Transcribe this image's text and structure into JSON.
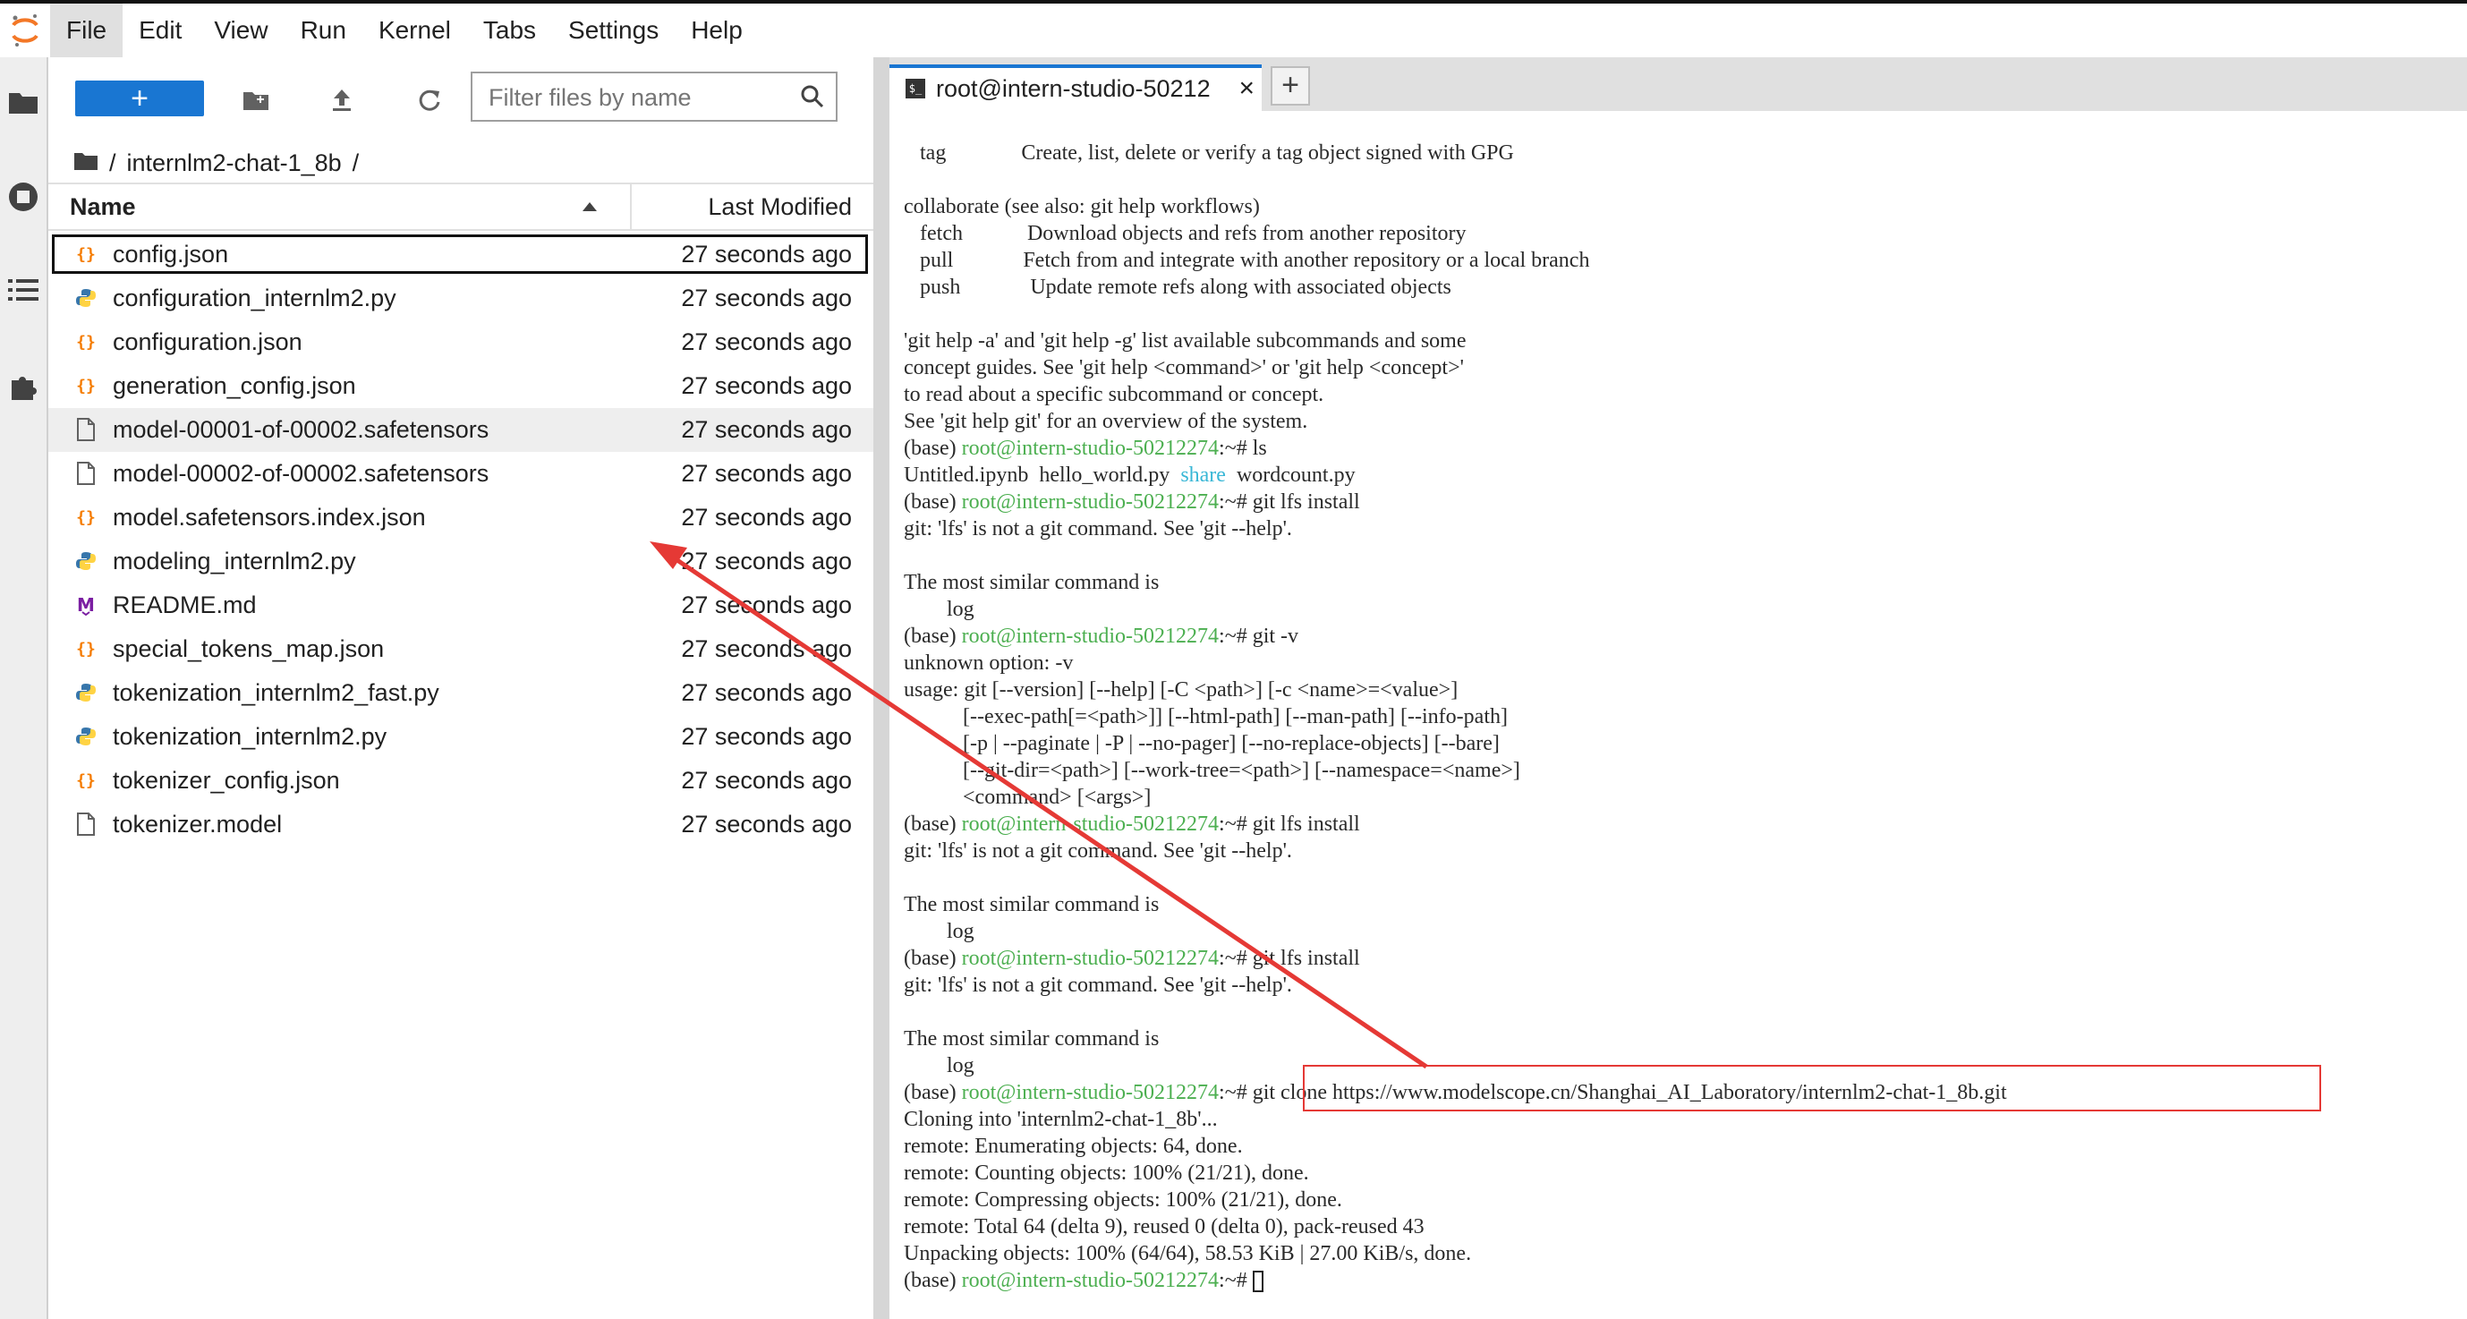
{
  "menubar": {
    "items": [
      "File",
      "Edit",
      "View",
      "Run",
      "Kernel",
      "Tabs",
      "Settings",
      "Help"
    ]
  },
  "filebrowser": {
    "new_label": "+",
    "filter_placeholder": "Filter files by name",
    "breadcrumb": {
      "root": "/",
      "folder": "internlm2-chat-1_8b",
      "sep": "/"
    },
    "columns": {
      "name": "Name",
      "modified": "Last Modified"
    },
    "files": [
      {
        "name": "config.json",
        "icon": "json-icon",
        "modified": "27 seconds ago"
      },
      {
        "name": "configuration_internlm2.py",
        "icon": "python-icon",
        "modified": "27 seconds ago"
      },
      {
        "name": "configuration.json",
        "icon": "json-icon",
        "modified": "27 seconds ago"
      },
      {
        "name": "generation_config.json",
        "icon": "json-icon",
        "modified": "27 seconds ago"
      },
      {
        "name": "model-00001-of-00002.safetensors",
        "icon": "file-icon",
        "modified": "27 seconds ago"
      },
      {
        "name": "model-00002-of-00002.safetensors",
        "icon": "file-icon",
        "modified": "27 seconds ago"
      },
      {
        "name": "model.safetensors.index.json",
        "icon": "json-icon",
        "modified": "27 seconds ago"
      },
      {
        "name": "modeling_internlm2.py",
        "icon": "python-icon",
        "modified": "27 seconds ago"
      },
      {
        "name": "README.md",
        "icon": "markdown-icon",
        "modified": "27 seconds ago"
      },
      {
        "name": "special_tokens_map.json",
        "icon": "json-icon",
        "modified": "27 seconds ago"
      },
      {
        "name": "tokenization_internlm2_fast.py",
        "icon": "python-icon",
        "modified": "27 seconds ago"
      },
      {
        "name": "tokenization_internlm2.py",
        "icon": "python-icon",
        "modified": "27 seconds ago"
      },
      {
        "name": "tokenizer_config.json",
        "icon": "json-icon",
        "modified": "27 seconds ago"
      },
      {
        "name": "tokenizer.model",
        "icon": "file-icon",
        "modified": "27 seconds ago"
      }
    ]
  },
  "terminal": {
    "tab_label": "root@intern-studio-50212",
    "tab_close": "×",
    "add_tab": "+",
    "prompt_base": "(base) ",
    "prompt_user": "root@intern-studio-50212274",
    "prompt_suffix": ":~# ",
    "lines": [
      {
        "text": "   tag              Create, list, delete or verify a tag object signed with GPG"
      },
      {
        "text": ""
      },
      {
        "text": "collaborate (see also: git help workflows)"
      },
      {
        "text": "   fetch            Download objects and refs from another repository"
      },
      {
        "text": "   pull             Fetch from and integrate with another repository or a local branch"
      },
      {
        "text": "   push             Update remote refs along with associated objects"
      },
      {
        "text": ""
      },
      {
        "text": "'git help -a' and 'git help -g' list available subcommands and some"
      },
      {
        "text": "concept guides. See 'git help <command>' or 'git help <concept>'"
      },
      {
        "text": "to read about a specific subcommand or concept."
      },
      {
        "text": "See 'git help git' for an overview of the system."
      },
      {
        "prompt": true,
        "cmd": "ls"
      },
      {
        "text": "Untitled.ipynb  hello_world.py  ",
        "colored": "share",
        "after": "  wordcount.py"
      },
      {
        "prompt": true,
        "cmd": "git lfs install"
      },
      {
        "text": "git: 'lfs' is not a git command. See 'git --help'."
      },
      {
        "text": ""
      },
      {
        "text": "The most similar command is"
      },
      {
        "text": "        log"
      },
      {
        "prompt": true,
        "cmd": "git -v"
      },
      {
        "text": "unknown option: -v"
      },
      {
        "text": "usage: git [--version] [--help] [-C <path>] [-c <name>=<value>]"
      },
      {
        "text": "           [--exec-path[=<path>]] [--html-path] [--man-path] [--info-path]"
      },
      {
        "text": "           [-p | --paginate | -P | --no-pager] [--no-replace-objects] [--bare]"
      },
      {
        "text": "           [--git-dir=<path>] [--work-tree=<path>] [--namespace=<name>]"
      },
      {
        "text": "           <command> [<args>]"
      },
      {
        "prompt": true,
        "cmd": "git lfs install"
      },
      {
        "text": "git: 'lfs' is not a git command. See 'git --help'."
      },
      {
        "text": ""
      },
      {
        "text": "The most similar command is"
      },
      {
        "text": "        log"
      },
      {
        "prompt": true,
        "cmd": "git lfs install"
      },
      {
        "text": "git: 'lfs' is not a git command. See 'git --help'."
      },
      {
        "text": ""
      },
      {
        "text": "The most similar command is"
      },
      {
        "text": "        log"
      },
      {
        "prompt": true,
        "cmd": "git clone https://www.modelscope.cn/Shanghai_AI_Laboratory/internlm2-chat-1_8b.git"
      },
      {
        "text": "Cloning into 'internlm2-chat-1_8b'..."
      },
      {
        "text": "remote: Enumerating objects: 64, done."
      },
      {
        "text": "remote: Counting objects: 100% (21/21), done."
      },
      {
        "text": "remote: Compressing objects: 100% (21/21), done."
      },
      {
        "text": "remote: Total 64 (delta 9), reused 0 (delta 0), pack-reused 43"
      },
      {
        "text": "Unpacking objects: 100% (64/64), 58.53 KiB | 27.00 KiB/s, done."
      },
      {
        "prompt": true,
        "cmd": "",
        "cursor": true
      }
    ]
  },
  "colors": {
    "accent": "#1976d2",
    "prompt_green": "#4caf50",
    "dir_cyan": "#39b7d6",
    "annotation_red": "#e53935",
    "json_orange": "#f57c00",
    "markdown_purple": "#7b1fa2"
  }
}
